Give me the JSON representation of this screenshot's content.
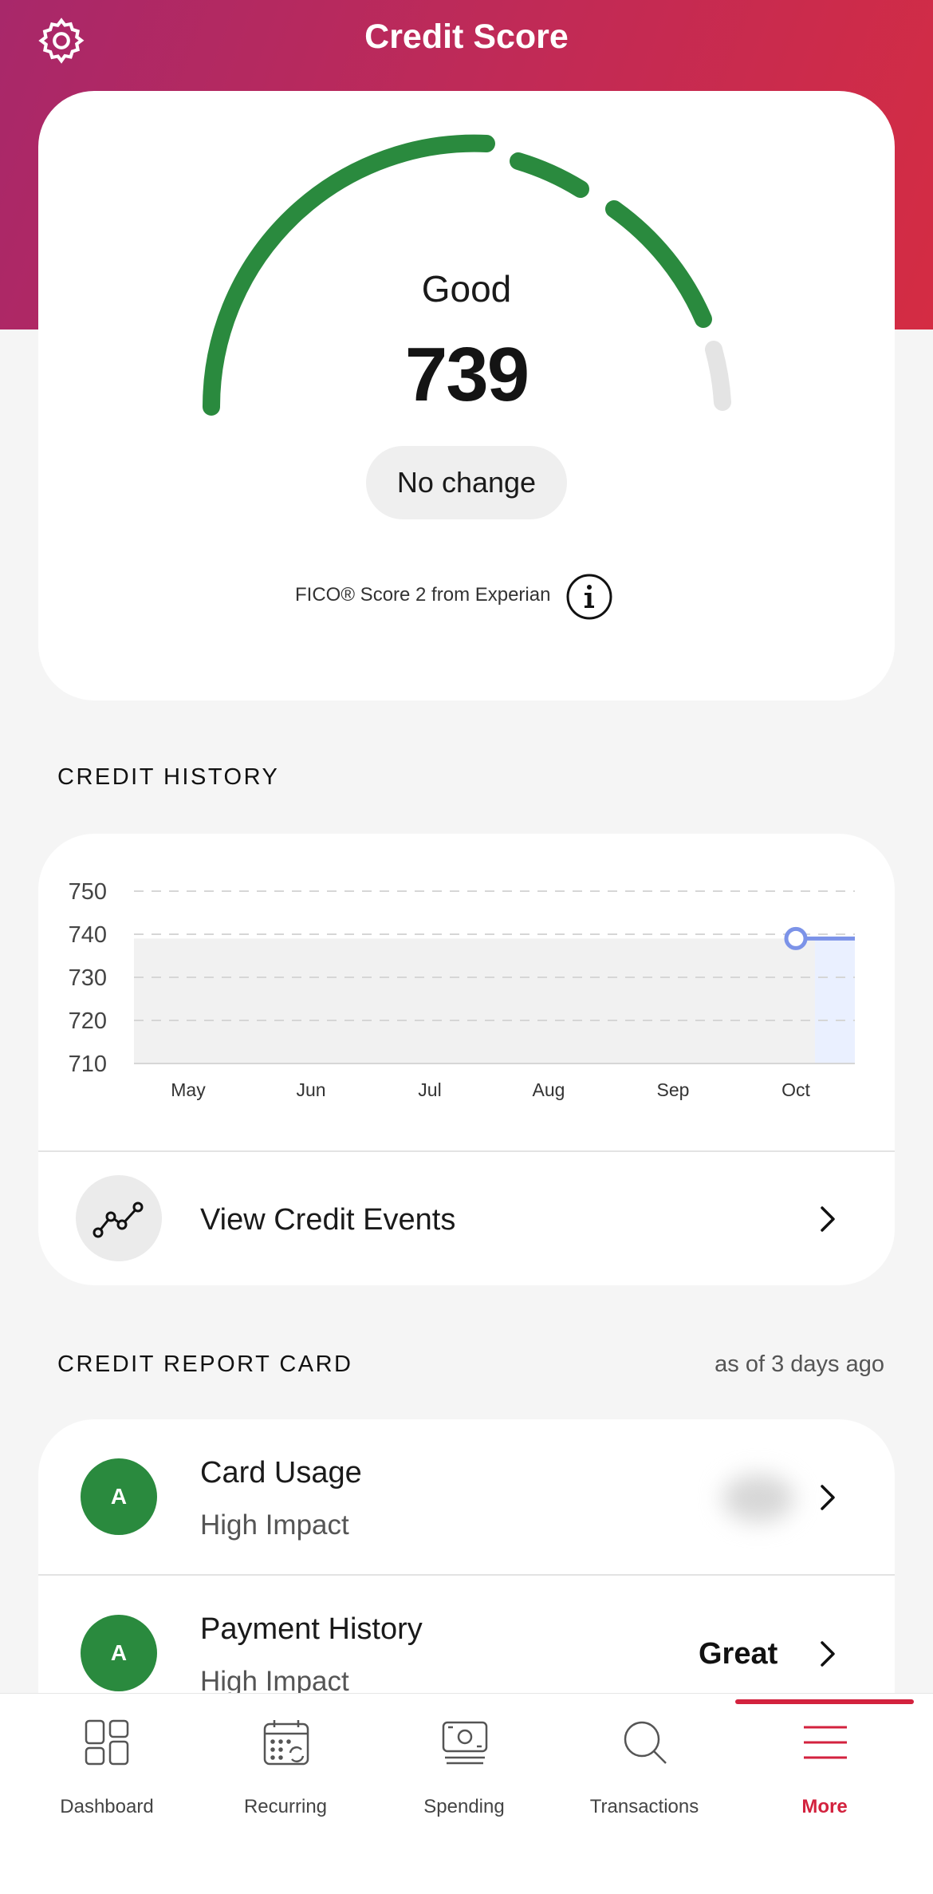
{
  "header": {
    "title": "Credit Score",
    "settings_icon": "gear-icon"
  },
  "score_card": {
    "rating": "Good",
    "score": "739",
    "change": "No change",
    "source": "FICO® Score 2 from Experian",
    "info_icon": "info-icon",
    "colors": {
      "good": "#2a8a3e",
      "empty": "#e4e4e4"
    }
  },
  "credit_history": {
    "section_title": "CREDIT HISTORY",
    "events_label": "View Credit Events",
    "events_icon": "trend-line-icon",
    "chart_data": {
      "type": "line",
      "categories": [
        "May",
        "Jun",
        "Jul",
        "Aug",
        "Sep",
        "Oct"
      ],
      "x": [
        "May",
        "Jun",
        "Jul",
        "Aug",
        "Sep",
        "Oct"
      ],
      "series": [
        {
          "values": [
            739,
            739,
            739,
            739,
            739,
            739
          ]
        }
      ],
      "ytick_labels": [
        "750",
        "740",
        "730",
        "720",
        "710"
      ],
      "ylim": [
        710,
        750
      ],
      "title": "",
      "xlabel": "",
      "ylabel": "",
      "grid": true,
      "highlight": "Oct",
      "colors": {
        "line": "#7c93e8",
        "fill": "#f1f1f1"
      }
    }
  },
  "report_card": {
    "section_title": "CREDIT REPORT CARD",
    "as_of": "as of 3 days ago",
    "items": [
      {
        "grade": "A",
        "title": "Card Usage",
        "subtitle": "High Impact",
        "value": ""
      },
      {
        "grade": "A",
        "title": "Payment History",
        "subtitle": "High Impact",
        "value": "Great"
      }
    ]
  },
  "tabbar": {
    "tabs": [
      {
        "label": "Dashboard",
        "icon": "dashboard-icon"
      },
      {
        "label": "Recurring",
        "icon": "calendar-icon"
      },
      {
        "label": "Spending",
        "icon": "money-icon"
      },
      {
        "label": "Transactions",
        "icon": "search-icon"
      },
      {
        "label": "More",
        "icon": "menu-icon",
        "active": true
      }
    ],
    "accent": "#d3223e"
  }
}
